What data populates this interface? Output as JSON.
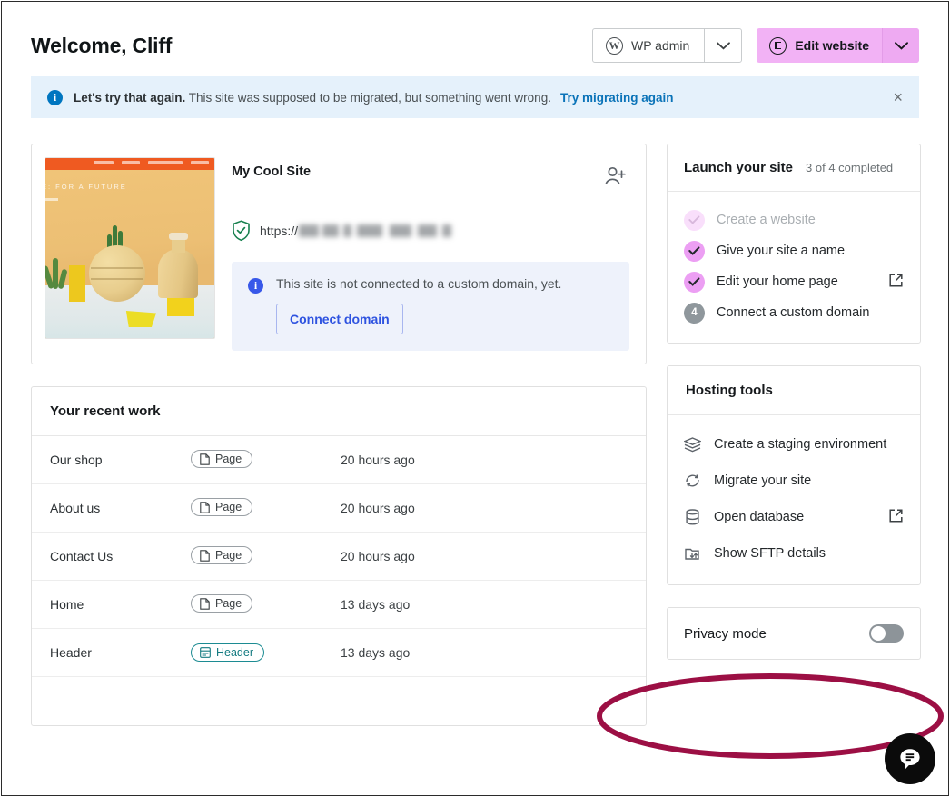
{
  "header": {
    "title": "Welcome, Cliff",
    "wp_admin_label": "WP admin",
    "wp_admin_mark": "W",
    "wp_admin_caret": "chevron-down-icon",
    "edit_website_label": "Edit website",
    "edit_website_caret": "chevron-down-icon",
    "primary_color": "#f2b2f5"
  },
  "banner": {
    "icon": "info-icon",
    "strong": "Let's try that again.",
    "message": " This site was supposed to be migrated, but something went wrong.",
    "link": "Try migrating again",
    "close": "×",
    "bg_color": "#e5f1fb",
    "link_color": "#0a73b8"
  },
  "site_card": {
    "thumbnail_alt": "site-screenshot-thumbnail",
    "thumbnail_heading": "E: FOR A FUTURE",
    "site_name": "My Cool Site",
    "invite_icon": "add-user-icon",
    "ssl_icon": "shield-check-icon",
    "url_prefix": "https://",
    "url_redacted": true,
    "notice": {
      "icon": "info-icon",
      "text": "This site is not connected to a custom domain, yet.",
      "button": "Connect domain",
      "bg_color": "#eef2fb",
      "button_color": "#2e53e0"
    }
  },
  "recent_work": {
    "title": "Your recent work",
    "rows": [
      {
        "name": "Our shop",
        "type": "Page",
        "type_icon": "page-icon",
        "time": "20 hours ago"
      },
      {
        "name": "About us",
        "type": "Page",
        "type_icon": "page-icon",
        "time": "20 hours ago"
      },
      {
        "name": "Contact Us",
        "type": "Page",
        "type_icon": "page-icon",
        "time": "20 hours ago"
      },
      {
        "name": "Home",
        "type": "Page",
        "type_icon": "page-icon",
        "time": "13 days ago"
      },
      {
        "name": "Header",
        "type": "Header",
        "type_icon": "header-icon",
        "time": "13 days ago"
      }
    ]
  },
  "launch": {
    "title": "Launch your site",
    "progress": "3 of 4 completed",
    "tasks": [
      {
        "label": "Create a website",
        "state": "completed-muted",
        "bullet": "check-icon",
        "external": false
      },
      {
        "label": "Give your site a name",
        "state": "completed",
        "bullet": "check-icon",
        "external": false
      },
      {
        "label": "Edit your home page",
        "state": "completed",
        "bullet": "check-icon",
        "external": true
      },
      {
        "label": "Connect a custom domain",
        "state": "pending",
        "bullet": "4",
        "external": false
      }
    ],
    "accent_color": "#ec9ff3"
  },
  "hosting": {
    "title": "Hosting tools",
    "tools": [
      {
        "label": "Create a staging environment",
        "icon": "layers-icon",
        "external": false
      },
      {
        "label": "Migrate your site",
        "icon": "sync-icon",
        "external": false
      },
      {
        "label": "Open database",
        "icon": "database-icon",
        "external": true
      },
      {
        "label": "Show SFTP details",
        "icon": "sftp-icon",
        "external": false
      }
    ]
  },
  "privacy": {
    "label": "Privacy mode",
    "enabled": false
  },
  "annotation": {
    "shape": "ellipse",
    "color": "#9c0f44",
    "target": "privacy-mode-card"
  },
  "chat_widget": {
    "icon": "chat-bubble-icon",
    "bg_color": "#0b0b0b"
  }
}
